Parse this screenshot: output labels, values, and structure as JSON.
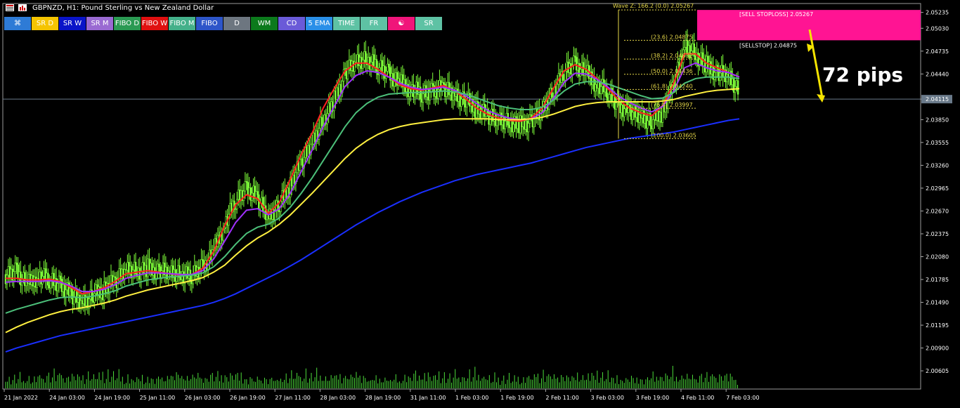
{
  "window": {
    "symbol_title": "GBPNZD, H1:  Pound Sterling vs New Zealand Dollar"
  },
  "toolbar": {
    "buttons": [
      {
        "label": "⌘",
        "name": "button-crosshair",
        "bg": "#2e7bd6"
      },
      {
        "label": "SR D",
        "name": "button-sr-d",
        "bg": "#f5c400"
      },
      {
        "label": "SR W",
        "name": "button-sr-w",
        "bg": "#0a14c8"
      },
      {
        "label": "SR M",
        "name": "button-sr-m",
        "bg": "#9a6ad2"
      },
      {
        "label": "FIBO D",
        "name": "button-fibo-d",
        "bg": "#2b9a53"
      },
      {
        "label": "FIBO W",
        "name": "button-fibo-w",
        "bg": "#e01010"
      },
      {
        "label": "FIBO M",
        "name": "button-fibo-m",
        "bg": "#44b08a"
      },
      {
        "label": "FIBO",
        "name": "button-fibo",
        "bg": "#2d55c9"
      },
      {
        "label": "D",
        "name": "button-d",
        "bg": "#6d7680"
      },
      {
        "label": "WM",
        "name": "button-wm",
        "bg": "#0c7a1c"
      },
      {
        "label": "CD",
        "name": "button-cd",
        "bg": "#6a5ad8"
      },
      {
        "label": "5 EMA",
        "name": "button-5-ema",
        "bg": "#2a8fe8"
      },
      {
        "label": "TIME",
        "name": "button-time",
        "bg": "#5ec2a4"
      },
      {
        "label": "FR",
        "name": "button-fr",
        "bg": "#5ec2a4"
      },
      {
        "label": "☯",
        "name": "button-yin-yang",
        "bg": "#f0157a"
      },
      {
        "label": "SR",
        "name": "button-sr",
        "bg": "#5ec2a4"
      }
    ]
  },
  "chart_data": {
    "type": "candlestick",
    "symbol": "GBPNZD",
    "timeframe": "H1",
    "price_axis": {
      "labels": [
        "2.05235",
        "2.05030",
        "2.04735",
        "2.04440",
        "2.04115",
        "2.03850",
        "2.03555",
        "2.03260",
        "2.02965",
        "2.02670",
        "2.02375",
        "2.02080",
        "2.01785",
        "2.01490",
        "2.01195",
        "2.00900",
        "2.00605"
      ],
      "values": [
        2.05235,
        2.0503,
        2.04735,
        2.0444,
        2.04115,
        2.0385,
        2.03555,
        2.0326,
        2.02965,
        2.0267,
        2.02375,
        2.0208,
        2.01785,
        2.0149,
        2.01195,
        2.009,
        2.00605
      ],
      "ylim": [
        2.0037,
        2.0535
      ],
      "current_price": "2.04115"
    },
    "time_axis": {
      "labels": [
        "21 Jan 2022",
        "24 Jan 03:00",
        "24 Jan 19:00",
        "25 Jan 11:00",
        "26 Jan 03:00",
        "26 Jan 19:00",
        "27 Jan 11:00",
        "28 Jan 03:00",
        "28 Jan 19:00",
        "31 Jan 11:00",
        "1 Feb 03:00",
        "1 Feb 19:00",
        "2 Feb 11:00",
        "3 Feb 03:00",
        "3 Feb 19:00",
        "4 Feb 11:00",
        "7 Feb 03:00"
      ]
    },
    "series": [
      {
        "name": "close",
        "color": "#7fff3a",
        "values": [
          2.0185,
          2.019,
          2.0172,
          2.0183,
          2.0178,
          2.017,
          2.016,
          2.015,
          2.0158,
          2.0165,
          2.0176,
          2.0192,
          2.019,
          2.0193,
          2.0189,
          2.0186,
          2.0184,
          2.0185,
          2.0195,
          2.0215,
          2.025,
          2.028,
          2.0295,
          2.0285,
          2.026,
          2.0275,
          2.03,
          2.033,
          2.0355,
          2.0385,
          2.041,
          2.0445,
          2.0458,
          2.0462,
          2.0455,
          2.0445,
          2.0432,
          2.0425,
          2.0418,
          2.042,
          2.0428,
          2.0418,
          2.041,
          2.0398,
          2.039,
          2.0385,
          2.0382,
          2.0378,
          2.0383,
          2.0395,
          2.042,
          2.0448,
          2.0458,
          2.0445,
          2.043,
          2.042,
          2.04,
          2.0398,
          2.039,
          2.0382,
          2.0395,
          2.043,
          2.048,
          2.047,
          2.0455,
          2.0445,
          2.044,
          2.0418
        ]
      },
      {
        "name": "ema-red",
        "color": "#ff2020",
        "values": [
          2.018,
          2.018,
          2.0178,
          2.0178,
          2.0179,
          2.0176,
          2.0168,
          2.016,
          2.0163,
          2.0168,
          2.0176,
          2.0186,
          2.0188,
          2.019,
          2.0188,
          2.0186,
          2.0184,
          2.0185,
          2.0193,
          2.0215,
          2.0248,
          2.0275,
          2.0288,
          2.0283,
          2.0264,
          2.0278,
          2.0308,
          2.034,
          2.0368,
          2.04,
          2.0425,
          2.0448,
          2.0458,
          2.0458,
          2.045,
          2.044,
          2.043,
          2.0425,
          2.0423,
          2.0426,
          2.0429,
          2.0422,
          2.0412,
          2.04,
          2.0392,
          2.0387,
          2.0384,
          2.0383,
          2.0387,
          2.04,
          2.0425,
          2.0448,
          2.0456,
          2.045,
          2.0438,
          2.0425,
          2.041,
          2.04,
          2.0394,
          2.039,
          2.0403,
          2.0432,
          2.047,
          2.047,
          2.0458,
          2.0452,
          2.0446,
          2.044
        ]
      },
      {
        "name": "ema-purple",
        "color": "#a030ff",
        "values": [
          2.0175,
          2.0176,
          2.0176,
          2.0176,
          2.0177,
          2.0175,
          2.017,
          2.0163,
          2.0163,
          2.0166,
          2.0172,
          2.018,
          2.0184,
          2.0187,
          2.0187,
          2.0186,
          2.0185,
          2.0185,
          2.019,
          2.0205,
          2.0228,
          2.0252,
          2.0268,
          2.027,
          2.0262,
          2.027,
          2.029,
          2.0318,
          2.0346,
          2.0376,
          2.0402,
          2.0428,
          2.0442,
          2.0448,
          2.0446,
          2.044,
          2.0432,
          2.0427,
          2.0424,
          2.0425,
          2.0427,
          2.0423,
          2.0416,
          2.0406,
          2.0397,
          2.0391,
          2.0387,
          2.0385,
          2.0386,
          2.0394,
          2.0412,
          2.0433,
          2.0445,
          2.0444,
          2.0437,
          2.0427,
          2.0415,
          2.0407,
          2.04,
          2.0395,
          2.0402,
          2.0422,
          2.0452,
          2.0458,
          2.0452,
          2.0448,
          2.0446,
          2.044
        ]
      },
      {
        "name": "ema-green",
        "color": "#4cc07a",
        "values": [
          2.0135,
          2.014,
          2.0144,
          2.0148,
          2.0152,
          2.0155,
          2.0156,
          2.0155,
          2.0157,
          2.016,
          2.0164,
          2.017,
          2.0174,
          2.0178,
          2.018,
          2.0182,
          2.0183,
          2.0184,
          2.0187,
          2.0195,
          2.0208,
          2.0224,
          2.0238,
          2.0246,
          2.025,
          2.0258,
          2.0272,
          2.029,
          2.031,
          2.0332,
          2.0354,
          2.0376,
          2.0394,
          2.0406,
          2.0414,
          2.0418,
          2.0419,
          2.042,
          2.042,
          2.0421,
          2.0422,
          2.0421,
          2.0418,
          2.0413,
          2.0408,
          2.0403,
          2.04,
          2.0398,
          2.0398,
          2.0401,
          2.041,
          2.0422,
          2.0431,
          2.0434,
          2.0434,
          2.0431,
          2.0426,
          2.0421,
          2.0416,
          2.0412,
          2.0413,
          2.042,
          2.0432,
          2.0438,
          2.044,
          2.044,
          2.044,
          2.0438
        ]
      },
      {
        "name": "ema-yellow",
        "color": "#fff040",
        "values": [
          2.011,
          2.0117,
          2.0123,
          2.0128,
          2.0133,
          2.0137,
          2.014,
          2.0142,
          2.0145,
          2.0148,
          2.0152,
          2.0157,
          2.0161,
          2.0165,
          2.0168,
          2.0171,
          2.0174,
          2.0177,
          2.0181,
          2.0188,
          2.0197,
          2.021,
          2.0222,
          2.0232,
          2.024,
          2.025,
          2.0262,
          2.0276,
          2.029,
          2.0305,
          2.032,
          2.0335,
          2.0348,
          2.0358,
          2.0366,
          2.0372,
          2.0376,
          2.0379,
          2.0381,
          2.0383,
          2.0385,
          2.0386,
          2.0386,
          2.0386,
          2.0386,
          2.0385,
          2.0385,
          2.0385,
          2.0386,
          2.0388,
          2.0392,
          2.0397,
          2.0402,
          2.0405,
          2.0407,
          2.0408,
          2.0408,
          2.0408,
          2.0408,
          2.0408,
          2.0409,
          2.0411,
          2.0415,
          2.0418,
          2.0421,
          2.0423,
          2.0424,
          2.0425
        ]
      },
      {
        "name": "ema-blue",
        "color": "#1a2fff",
        "values": [
          2.0085,
          2.009,
          2.0094,
          2.0098,
          2.0102,
          2.0106,
          2.0109,
          2.0112,
          2.0115,
          2.0118,
          2.0121,
          2.0124,
          2.0127,
          2.013,
          2.0133,
          2.0136,
          2.0139,
          2.0142,
          2.0145,
          2.0149,
          2.0154,
          2.016,
          2.0167,
          2.0174,
          2.0181,
          2.0188,
          2.0196,
          2.0204,
          2.0213,
          2.0222,
          2.0231,
          2.024,
          2.0249,
          2.0257,
          2.0265,
          2.0272,
          2.0279,
          2.0285,
          2.0291,
          2.0296,
          2.0301,
          2.0306,
          2.031,
          2.0314,
          2.0317,
          2.032,
          2.0323,
          2.0326,
          2.0329,
          2.0333,
          2.0337,
          2.0341,
          2.0345,
          2.0349,
          2.0352,
          2.0355,
          2.0358,
          2.0361,
          2.0363,
          2.0365,
          2.0367,
          2.0369,
          2.0372,
          2.0375,
          2.0378,
          2.0381,
          2.0384,
          2.0386
        ]
      }
    ],
    "volume": [
      34,
      22,
      28,
      18,
      25,
      31,
      20,
      26,
      35,
      22,
      19,
      28,
      24,
      30,
      21,
      18,
      27,
      25,
      33,
      28,
      36,
      24,
      30,
      41,
      38,
      27,
      33,
      45,
      29,
      37,
      32,
      48,
      26,
      30,
      35,
      28,
      31,
      44,
      27,
      33,
      39,
      25,
      29,
      34,
      23,
      30,
      41,
      35,
      28,
      32,
      37,
      26,
      34,
      30,
      43,
      27,
      31,
      46,
      29,
      35,
      39,
      33,
      28,
      41,
      25,
      30,
      22,
      18
    ],
    "fibonacci": {
      "wave_label": "Wave Z: 166.2 (0.0) 2.05267",
      "levels": [
        {
          "label": "(23.6) 2.04875",
          "price": 2.04875
        },
        {
          "label": "(38.2) 2.04632",
          "price": 2.04632
        },
        {
          "label": "(50.0) 2.04436",
          "price": 2.04436
        },
        {
          "label": "(61.8) 2.04240",
          "price": 2.0424
        },
        {
          "label": "(76.4) 2.03997",
          "price": 2.03997
        },
        {
          "label": "(100.0) 2.03605",
          "price": 2.03605
        }
      ]
    },
    "orders": {
      "sell_stoploss": {
        "label": "[SELL STOPLOSS] 2.05267",
        "price": 2.05267,
        "color": "#ff1493"
      },
      "sell_stop": {
        "label": "[SELLSTOP] 2.04875",
        "price": 2.04875
      }
    },
    "annotation": {
      "text": "72 pips",
      "color": "#f5e400"
    }
  }
}
